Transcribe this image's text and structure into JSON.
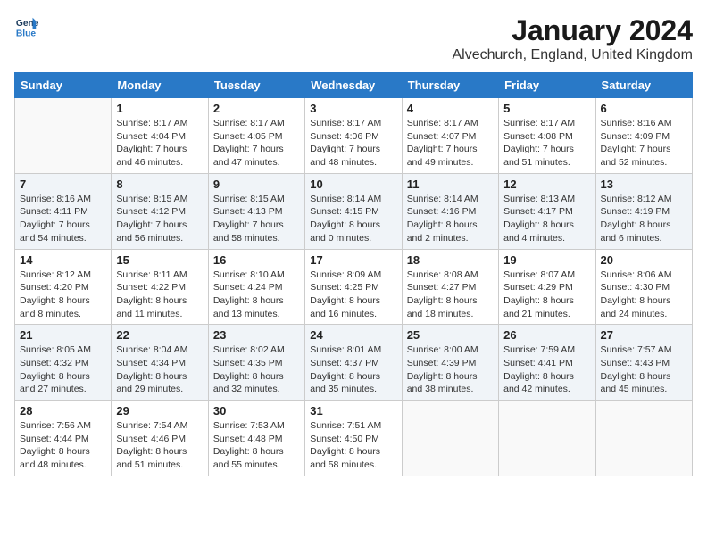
{
  "header": {
    "logo_line1": "General",
    "logo_line2": "Blue",
    "title": "January 2024",
    "subtitle": "Alvechurch, England, United Kingdom"
  },
  "columns": [
    "Sunday",
    "Monday",
    "Tuesday",
    "Wednesday",
    "Thursday",
    "Friday",
    "Saturday"
  ],
  "weeks": [
    [
      {
        "day": "",
        "text": ""
      },
      {
        "day": "1",
        "text": "Sunrise: 8:17 AM\nSunset: 4:04 PM\nDaylight: 7 hours\nand 46 minutes."
      },
      {
        "day": "2",
        "text": "Sunrise: 8:17 AM\nSunset: 4:05 PM\nDaylight: 7 hours\nand 47 minutes."
      },
      {
        "day": "3",
        "text": "Sunrise: 8:17 AM\nSunset: 4:06 PM\nDaylight: 7 hours\nand 48 minutes."
      },
      {
        "day": "4",
        "text": "Sunrise: 8:17 AM\nSunset: 4:07 PM\nDaylight: 7 hours\nand 49 minutes."
      },
      {
        "day": "5",
        "text": "Sunrise: 8:17 AM\nSunset: 4:08 PM\nDaylight: 7 hours\nand 51 minutes."
      },
      {
        "day": "6",
        "text": "Sunrise: 8:16 AM\nSunset: 4:09 PM\nDaylight: 7 hours\nand 52 minutes."
      }
    ],
    [
      {
        "day": "7",
        "text": "Sunrise: 8:16 AM\nSunset: 4:11 PM\nDaylight: 7 hours\nand 54 minutes."
      },
      {
        "day": "8",
        "text": "Sunrise: 8:15 AM\nSunset: 4:12 PM\nDaylight: 7 hours\nand 56 minutes."
      },
      {
        "day": "9",
        "text": "Sunrise: 8:15 AM\nSunset: 4:13 PM\nDaylight: 7 hours\nand 58 minutes."
      },
      {
        "day": "10",
        "text": "Sunrise: 8:14 AM\nSunset: 4:15 PM\nDaylight: 8 hours\nand 0 minutes."
      },
      {
        "day": "11",
        "text": "Sunrise: 8:14 AM\nSunset: 4:16 PM\nDaylight: 8 hours\nand 2 minutes."
      },
      {
        "day": "12",
        "text": "Sunrise: 8:13 AM\nSunset: 4:17 PM\nDaylight: 8 hours\nand 4 minutes."
      },
      {
        "day": "13",
        "text": "Sunrise: 8:12 AM\nSunset: 4:19 PM\nDaylight: 8 hours\nand 6 minutes."
      }
    ],
    [
      {
        "day": "14",
        "text": "Sunrise: 8:12 AM\nSunset: 4:20 PM\nDaylight: 8 hours\nand 8 minutes."
      },
      {
        "day": "15",
        "text": "Sunrise: 8:11 AM\nSunset: 4:22 PM\nDaylight: 8 hours\nand 11 minutes."
      },
      {
        "day": "16",
        "text": "Sunrise: 8:10 AM\nSunset: 4:24 PM\nDaylight: 8 hours\nand 13 minutes."
      },
      {
        "day": "17",
        "text": "Sunrise: 8:09 AM\nSunset: 4:25 PM\nDaylight: 8 hours\nand 16 minutes."
      },
      {
        "day": "18",
        "text": "Sunrise: 8:08 AM\nSunset: 4:27 PM\nDaylight: 8 hours\nand 18 minutes."
      },
      {
        "day": "19",
        "text": "Sunrise: 8:07 AM\nSunset: 4:29 PM\nDaylight: 8 hours\nand 21 minutes."
      },
      {
        "day": "20",
        "text": "Sunrise: 8:06 AM\nSunset: 4:30 PM\nDaylight: 8 hours\nand 24 minutes."
      }
    ],
    [
      {
        "day": "21",
        "text": "Sunrise: 8:05 AM\nSunset: 4:32 PM\nDaylight: 8 hours\nand 27 minutes."
      },
      {
        "day": "22",
        "text": "Sunrise: 8:04 AM\nSunset: 4:34 PM\nDaylight: 8 hours\nand 29 minutes."
      },
      {
        "day": "23",
        "text": "Sunrise: 8:02 AM\nSunset: 4:35 PM\nDaylight: 8 hours\nand 32 minutes."
      },
      {
        "day": "24",
        "text": "Sunrise: 8:01 AM\nSunset: 4:37 PM\nDaylight: 8 hours\nand 35 minutes."
      },
      {
        "day": "25",
        "text": "Sunrise: 8:00 AM\nSunset: 4:39 PM\nDaylight: 8 hours\nand 38 minutes."
      },
      {
        "day": "26",
        "text": "Sunrise: 7:59 AM\nSunset: 4:41 PM\nDaylight: 8 hours\nand 42 minutes."
      },
      {
        "day": "27",
        "text": "Sunrise: 7:57 AM\nSunset: 4:43 PM\nDaylight: 8 hours\nand 45 minutes."
      }
    ],
    [
      {
        "day": "28",
        "text": "Sunrise: 7:56 AM\nSunset: 4:44 PM\nDaylight: 8 hours\nand 48 minutes."
      },
      {
        "day": "29",
        "text": "Sunrise: 7:54 AM\nSunset: 4:46 PM\nDaylight: 8 hours\nand 51 minutes."
      },
      {
        "day": "30",
        "text": "Sunrise: 7:53 AM\nSunset: 4:48 PM\nDaylight: 8 hours\nand 55 minutes."
      },
      {
        "day": "31",
        "text": "Sunrise: 7:51 AM\nSunset: 4:50 PM\nDaylight: 8 hours\nand 58 minutes."
      },
      {
        "day": "",
        "text": ""
      },
      {
        "day": "",
        "text": ""
      },
      {
        "day": "",
        "text": ""
      }
    ]
  ]
}
